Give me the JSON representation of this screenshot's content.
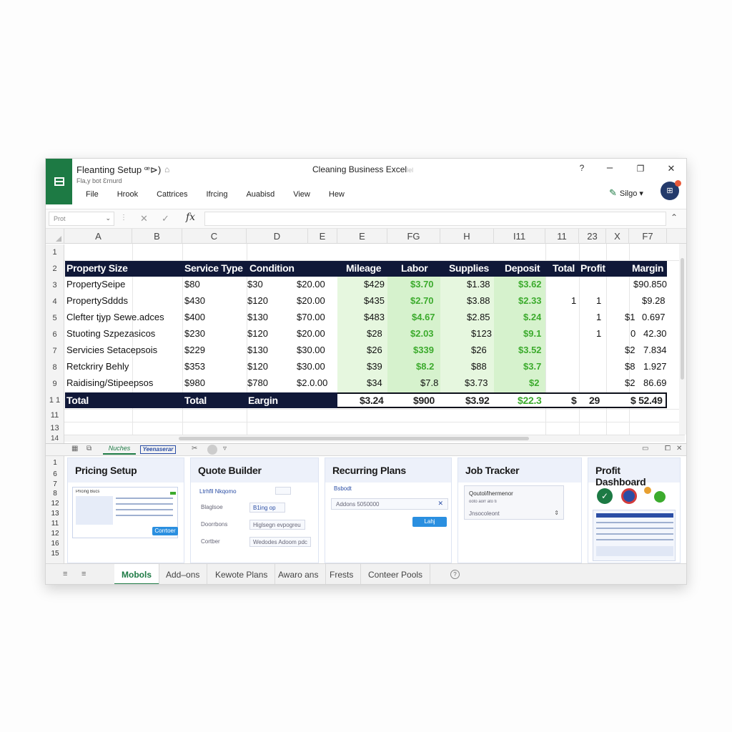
{
  "titlebar": {
    "doc_title": "Fleanting Setup ꟹ⊳)",
    "doc_subtitle": "Fla,y bot Ɛrnurd",
    "window_title": "Cleaning Business Excel",
    "window_title_faint": "lel",
    "help": "?",
    "minimize": "–",
    "restore": "❐",
    "close": "✕",
    "share_label": "Silgo ▾",
    "avatar_text": "⊞"
  },
  "menu": [
    "File",
    "Hrook",
    "Cattrices",
    "Ifrcing",
    "Auabisd",
    "View",
    "Hew"
  ],
  "formula_bar": {
    "name_box": "Prot",
    "fx": "fx",
    "value": ""
  },
  "columns": [
    "A",
    "B",
    "C",
    "D",
    "E",
    "E",
    "FG",
    "H",
    "I11",
    "11",
    "23",
    "X",
    "F7"
  ],
  "row_numbers": [
    "1",
    "2",
    "3",
    "4",
    "5",
    "6",
    "7",
    "8",
    "9",
    "1 1",
    "11",
    "13",
    "14"
  ],
  "table": {
    "headers": [
      "Property Size",
      "Service Type",
      "Condition",
      "Mileage",
      "Labor",
      "Supplies",
      "Deposit",
      "Total",
      "Profit",
      "Margin"
    ],
    "rows": [
      {
        "a": "PropertySeipe",
        "b": "$80",
        "c": "$30",
        "d": "$20.00",
        "mileage": "$429",
        "labor": "$3.70",
        "supplies": "$1.38",
        "deposit": "$3.62",
        "total": "",
        "profit": "",
        "m1": "",
        "margin": "$90.850"
      },
      {
        "a": "PropertySddds",
        "b": "$430",
        "c": "$120",
        "d": "$20.00",
        "mileage": "$435",
        "labor": "$2.70",
        "supplies": "$3.88",
        "deposit": "$2.33",
        "total": "1",
        "profit": "1",
        "m1": "",
        "margin": "$9.28"
      },
      {
        "a": "Clefter tjyp Sewe.adces",
        "b": "$400",
        "c": "$130",
        "d": "$70.00",
        "mileage": "$483",
        "labor": "$4.67",
        "supplies": "$2.85",
        "deposit": "$.24",
        "total": "",
        "profit": "1",
        "m1": "$1",
        "margin": "0.697"
      },
      {
        "a": "Stuoting Szpezasicos",
        "b": "$230",
        "c": "$120",
        "d": "$20.00",
        "mileage": "$28",
        "labor": "$2.03",
        "supplies": "$123",
        "deposit": "$9.1",
        "total": "",
        "profit": "1",
        "m1": "0",
        "margin": "42.30"
      },
      {
        "a": "Servicies Setacepsois",
        "b": "$229",
        "c": "$130",
        "d": "$30.00",
        "mileage": "$26",
        "labor": "$339",
        "supplies": "$26",
        "deposit": "$3.52",
        "total": "",
        "profit": "",
        "m1": "$2",
        "margin": "7.834"
      },
      {
        "a": "Retckriry Behly",
        "b": "$353",
        "c": "$120",
        "d": "$30.00",
        "mileage": "$39",
        "labor": "$8.2",
        "supplies": "$88",
        "deposit": "$3.7",
        "total": "",
        "profit": "",
        "m1": "$8",
        "margin": "1.927"
      },
      {
        "a": "Raidising/Stipeepsos",
        "b": "$980",
        "c": "$780",
        "d": "$2.0.00",
        "mileage": "$34",
        "labor": "$7.8",
        "supplies": "$3.73",
        "deposit": "$2",
        "total": "",
        "profit": "",
        "m1": "$2",
        "margin": "86.69"
      }
    ],
    "total_row": {
      "a": "Total",
      "b": "Total",
      "c": "Eargin",
      "mileage": "$3.24",
      "labor": "$900",
      "supplies": "$3.92",
      "deposit": "$22.3",
      "total": "$",
      "profit": "29",
      "margin": "$ 52.49"
    }
  },
  "lower_tabs": {
    "tab1": "Nuches",
    "tab2": "Yeenaserar"
  },
  "lower_rows": [
    "1",
    "6",
    "7",
    "8",
    "12",
    "13",
    "11",
    "12",
    "16",
    "15"
  ],
  "panels": [
    {
      "title": "Pricing Setup",
      "items": [
        "Pricing Bucs",
        "Corrtoer"
      ]
    },
    {
      "title": "Quote Builder",
      "items": [
        "Ltrhfll Nkqomo",
        "Blaglsoe",
        "Doorrbons",
        "B1ing op",
        "Cortber",
        "Higlsegn evpogreu",
        "Wedodes Adoom pdc"
      ]
    },
    {
      "title": "Recurring Plans",
      "items": [
        "Bsbodt",
        "Addons 5050000",
        "Lahj"
      ]
    },
    {
      "title": "Job Tracker",
      "items": [
        "Qoutol/lhermenor",
        "ooto aorr ato ti",
        "Jnsocoleont"
      ]
    },
    {
      "title": "Profit Dashboard",
      "items": []
    }
  ],
  "sheet_tabs": [
    "Mobols",
    "Add–ons",
    "Kewote Plans",
    "Awaro ans",
    "Frests",
    "Conteer Pools"
  ],
  "colors": {
    "excel_green": "#1d7a44",
    "header_navy": "#101838",
    "value_green": "#3cab2d",
    "highlight_green": "#e6f7df"
  }
}
